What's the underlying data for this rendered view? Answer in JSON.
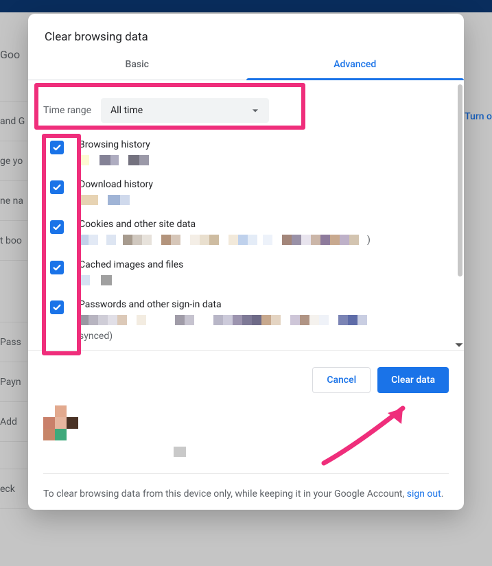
{
  "backdrop": {
    "sidebar_items": [
      "Goo",
      "",
      "and G",
      "ge yo",
      "ne na",
      "t boo",
      "",
      "Pass",
      "Payn",
      "Add",
      "",
      "eck"
    ],
    "right_link": "Turn o"
  },
  "modal": {
    "title": "Clear browsing data",
    "tabs": {
      "basic": "Basic",
      "advanced": "Advanced"
    },
    "time_range": {
      "label": "Time range",
      "value": "All time"
    },
    "items": [
      {
        "title": "Browsing history"
      },
      {
        "title": "Download history"
      },
      {
        "title": "Cookies and other site data",
        "trail_paren": ")"
      },
      {
        "title": "Cached images and files"
      },
      {
        "title": "Passwords and other sign-in data",
        "trail_text": "synced)"
      }
    ],
    "extra_pixel_strip": "",
    "note_prefix": "To clear browsing data from this device only, while keeping it in your Google Account, ",
    "note_link": "sign out",
    "note_suffix": ".",
    "buttons": {
      "cancel": "Cancel",
      "clear": "Clear data"
    }
  }
}
